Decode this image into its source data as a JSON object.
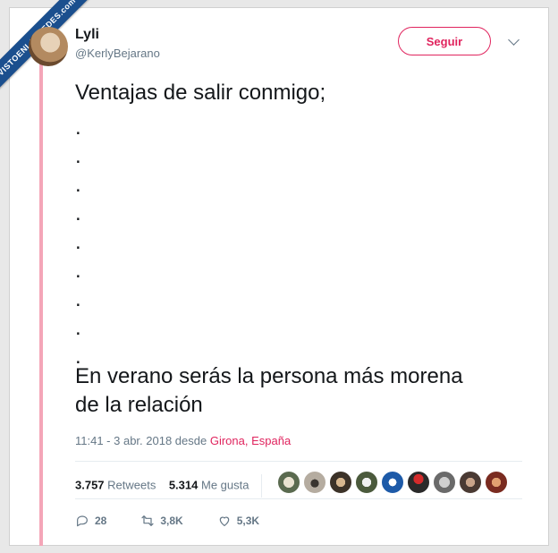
{
  "watermark": {
    "text": "VISTOENLASREDES.com"
  },
  "user": {
    "name": "Lyli",
    "handle": "@KerlyBejarano"
  },
  "follow_button": {
    "label": "Seguir"
  },
  "tweet": {
    "line1": "Ventajas de salir conmigo;",
    "dots": [
      ".",
      ".",
      ".",
      ".",
      ".",
      ".",
      ".",
      ".",
      "."
    ],
    "line2": "En verano serás la persona más morena",
    "line3": "de la relación"
  },
  "meta": {
    "datetime": "11:41 - 3 abr. 2018 desde",
    "city": "Girona",
    "sep": ",",
    "country": "España"
  },
  "stats": {
    "retweets_count": "3.757",
    "retweets_label": "Retweets",
    "likes_count": "5.314",
    "likes_label": "Me gusta"
  },
  "actions": {
    "replies": "28",
    "retweets": "3,8K",
    "likes": "5,3K"
  },
  "colors": {
    "accent": "#e0245e",
    "muted": "#657786",
    "text": "#14171a",
    "thread_line": "#f4a6b8"
  }
}
